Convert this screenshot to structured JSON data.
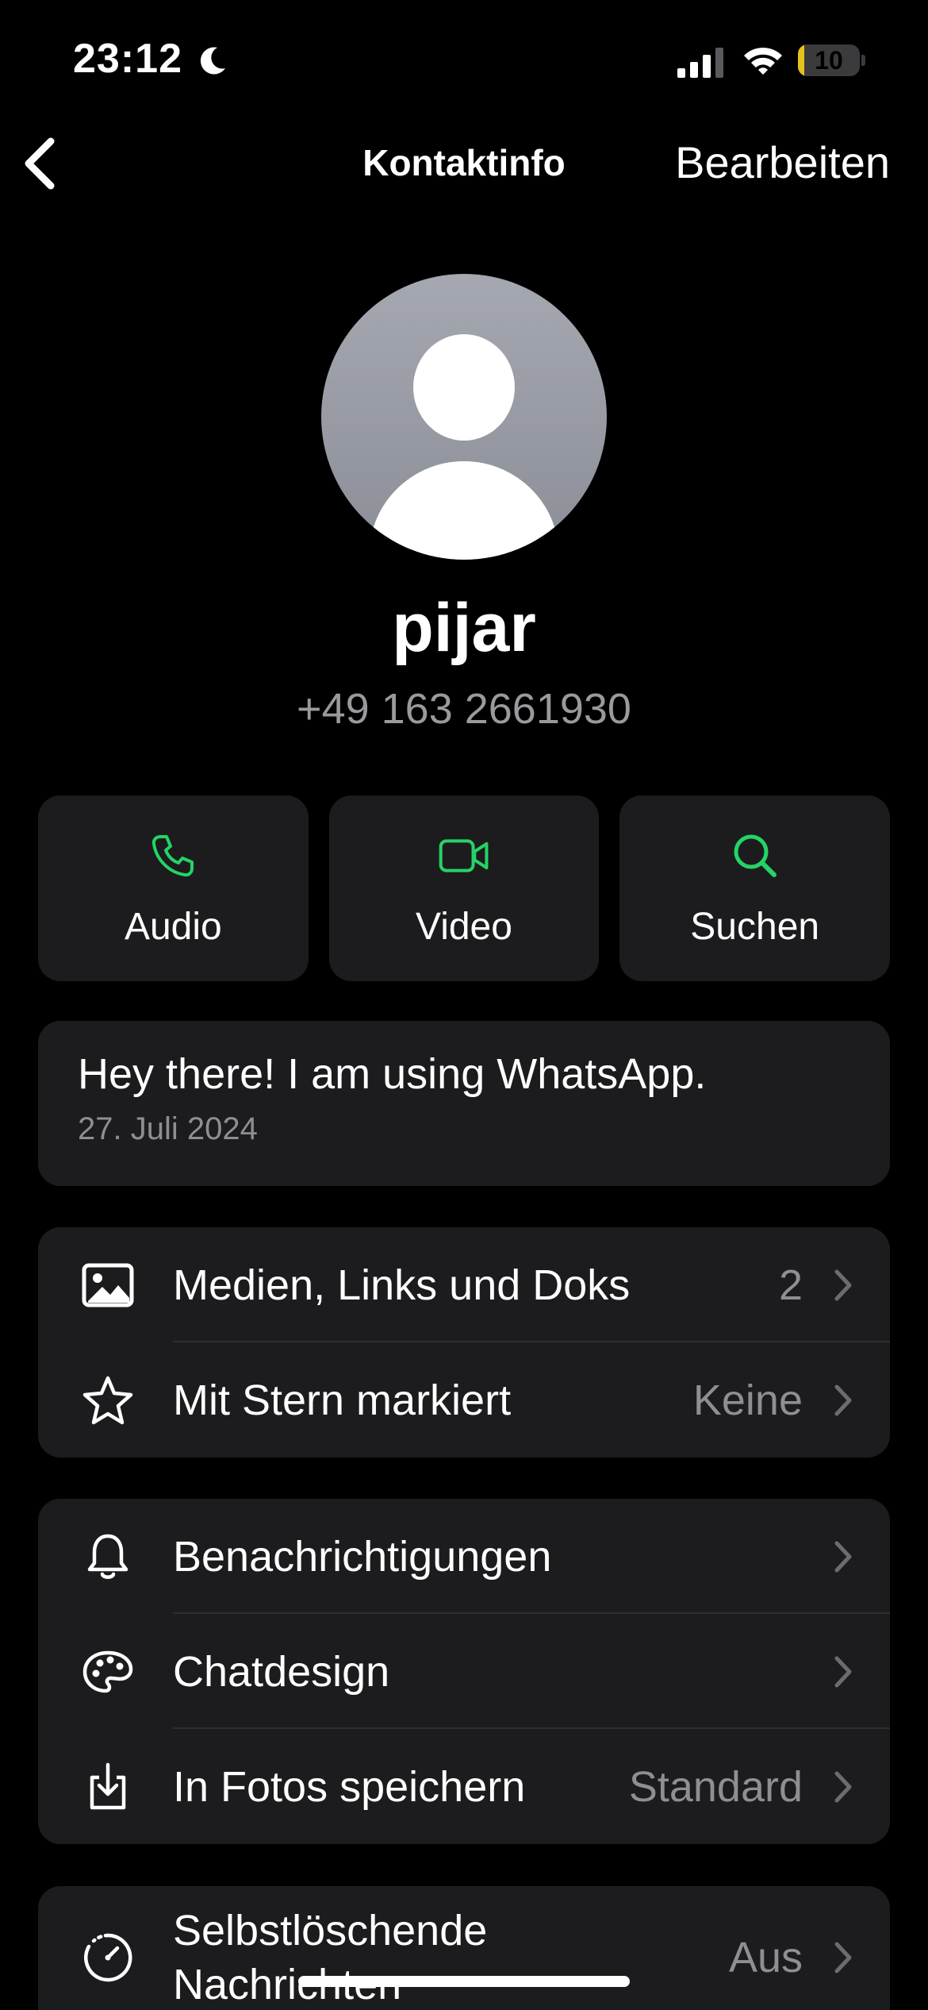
{
  "status_bar": {
    "time": "23:12",
    "battery_level": "10",
    "battery_fraction": 0.1
  },
  "nav": {
    "title": "Kontaktinfo",
    "edit_label": "Bearbeiten"
  },
  "contact": {
    "name": "pijar",
    "phone": "+49 163 2661930"
  },
  "actions": [
    {
      "label": "Audio",
      "icon": "phone-icon"
    },
    {
      "label": "Video",
      "icon": "video-icon"
    },
    {
      "label": "Suchen",
      "icon": "search-icon"
    }
  ],
  "about": {
    "text": "Hey there! I am using WhatsApp.",
    "date": "27. Juli 2024"
  },
  "groups": {
    "media": [
      {
        "label": "Medien, Links und Doks",
        "value": "2",
        "icon": "photo-icon"
      },
      {
        "label": "Mit Stern markiert",
        "value": "Keine",
        "icon": "star-icon"
      }
    ],
    "settings": [
      {
        "label": "Benachrichtigungen",
        "value": "",
        "icon": "bell-icon"
      },
      {
        "label": "Chatdesign",
        "value": "",
        "icon": "palette-icon"
      },
      {
        "label": "In Fotos speichern",
        "value": "Standard",
        "icon": "save-to-photos-icon"
      }
    ],
    "privacy": [
      {
        "label_line1": "Selbstlöschende",
        "label_line2": "Nachrichten",
        "value": "Aus",
        "icon": "timer-icon"
      }
    ]
  },
  "colors": {
    "accent": "#25d366",
    "background": "#000000",
    "card": "#1c1c1e",
    "secondary_text": "#8e8e93",
    "battery": "#e6c21c"
  }
}
